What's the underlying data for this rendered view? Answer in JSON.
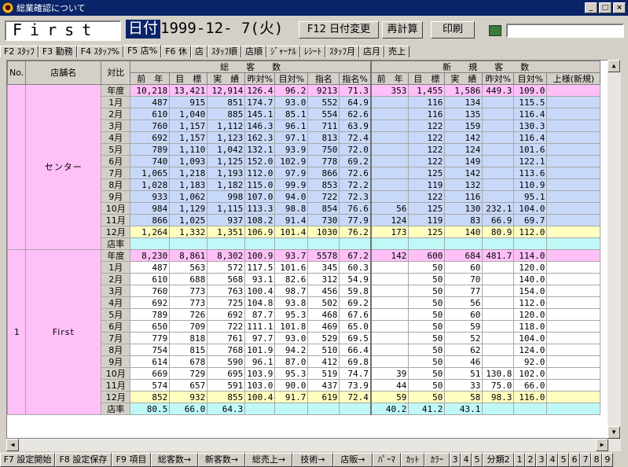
{
  "window": {
    "title": "総業確認について",
    "minimize": "_",
    "maximize": "□",
    "close": "×"
  },
  "toolbar": {
    "store_name": "First",
    "date_label": "日付",
    "date_value": "1999-12- 7(火)",
    "btn_date_change": "F12 日付変更",
    "btn_recalc": "再計算",
    "btn_print": "印刷",
    "calc_value": ""
  },
  "tabs": [
    "F2 ｽﾀｯﾌ",
    "F3 勤務",
    "F4 ｽﾀｯﾌ%",
    "F5 店%",
    "F6 休",
    "店",
    "ｽﾀｯﾌ順",
    "店順",
    "ｼﾞｬｰﾅﾙ",
    "ﾚｼｰﾄ",
    "ｽﾀｯﾌ月",
    "店月",
    "売上"
  ],
  "active_tab": 3,
  "header": {
    "no": "No.",
    "store": "店舗名",
    "compare": "対比",
    "group1": "総　　客　　数",
    "group2": "新　　規　　客　　数",
    "cols1": [
      "前　年",
      "目　標",
      "実　績",
      "昨対%",
      "目対%",
      "指名",
      "指名%"
    ],
    "cols2": [
      "前　年",
      "目　標",
      "実　績",
      "昨対%",
      "目対%",
      "上様(新規)"
    ]
  },
  "sections": [
    {
      "no": "",
      "store": "センター",
      "rows": [
        {
          "m": "年度",
          "t": "year",
          "v": [
            "10,218",
            "13,421",
            "12,914",
            "126.4",
            "96.2",
            "9213",
            "71.3",
            "353",
            "1,455",
            "1,586",
            "449.3",
            "109.0",
            ""
          ]
        },
        {
          "m": "1月",
          "t": "month",
          "v": [
            "487",
            "915",
            "851",
            "174.7",
            "93.0",
            "552",
            "64.9",
            "",
            "116",
            "134",
            "",
            "115.5",
            ""
          ]
        },
        {
          "m": "2月",
          "t": "month",
          "v": [
            "610",
            "1,040",
            "885",
            "145.1",
            "85.1",
            "554",
            "62.6",
            "",
            "116",
            "135",
            "",
            "116.4",
            ""
          ]
        },
        {
          "m": "3月",
          "t": "month",
          "v": [
            "760",
            "1,157",
            "1,112",
            "146.3",
            "96.1",
            "711",
            "63.9",
            "",
            "122",
            "159",
            "",
            "130.3",
            ""
          ]
        },
        {
          "m": "4月",
          "t": "month",
          "v": [
            "692",
            "1,157",
            "1,123",
            "162.3",
            "97.1",
            "813",
            "72.4",
            "",
            "122",
            "142",
            "",
            "116.4",
            ""
          ]
        },
        {
          "m": "5月",
          "t": "month",
          "v": [
            "789",
            "1,110",
            "1,042",
            "132.1",
            "93.9",
            "750",
            "72.0",
            "",
            "122",
            "124",
            "",
            "101.6",
            ""
          ]
        },
        {
          "m": "6月",
          "t": "month",
          "v": [
            "740",
            "1,093",
            "1,125",
            "152.0",
            "102.9",
            "778",
            "69.2",
            "",
            "122",
            "149",
            "",
            "122.1",
            ""
          ]
        },
        {
          "m": "7月",
          "t": "month",
          "v": [
            "1,065",
            "1,218",
            "1,193",
            "112.0",
            "97.9",
            "866",
            "72.6",
            "",
            "125",
            "142",
            "",
            "113.6",
            ""
          ]
        },
        {
          "m": "8月",
          "t": "month",
          "v": [
            "1,028",
            "1,183",
            "1,182",
            "115.0",
            "99.9",
            "853",
            "72.2",
            "",
            "119",
            "132",
            "",
            "110.9",
            ""
          ]
        },
        {
          "m": "9月",
          "t": "month",
          "v": [
            "933",
            "1,062",
            "998",
            "107.0",
            "94.0",
            "722",
            "72.3",
            "",
            "122",
            "116",
            "",
            "95.1",
            ""
          ]
        },
        {
          "m": "10月",
          "t": "month",
          "v": [
            "984",
            "1,129",
            "1,115",
            "113.3",
            "98.8",
            "854",
            "76.6",
            "56",
            "125",
            "130",
            "232.1",
            "104.0",
            ""
          ]
        },
        {
          "m": "11月",
          "t": "month",
          "v": [
            "866",
            "1,025",
            "937",
            "108.2",
            "91.4",
            "730",
            "77.9",
            "124",
            "119",
            "83",
            "66.9",
            "69.7",
            ""
          ]
        },
        {
          "m": "12月",
          "t": "dec",
          "v": [
            "1,264",
            "1,332",
            "1,351",
            "106.9",
            "101.4",
            "1030",
            "76.2",
            "173",
            "125",
            "140",
            "80.9",
            "112.0",
            ""
          ]
        },
        {
          "m": "店率",
          "t": "ratio",
          "v": [
            "",
            "",
            "",
            "",
            "",
            "",
            "",
            "",
            "",
            "",
            "",
            "",
            ""
          ]
        }
      ]
    },
    {
      "no": "1",
      "store": "First",
      "rows": [
        {
          "m": "年度",
          "t": "year",
          "v": [
            "8,230",
            "8,861",
            "8,302",
            "100.9",
            "93.7",
            "5578",
            "67.2",
            "142",
            "600",
            "684",
            "481.7",
            "114.0",
            ""
          ]
        },
        {
          "m": "1月",
          "t": "month2",
          "v": [
            "487",
            "563",
            "572",
            "117.5",
            "101.6",
            "345",
            "60.3",
            "",
            "50",
            "60",
            "",
            "120.0",
            ""
          ]
        },
        {
          "m": "2月",
          "t": "month2",
          "v": [
            "610",
            "688",
            "568",
            "93.1",
            "82.6",
            "312",
            "54.9",
            "",
            "50",
            "70",
            "",
            "140.0",
            ""
          ]
        },
        {
          "m": "3月",
          "t": "month2",
          "v": [
            "760",
            "773",
            "763",
            "100.4",
            "98.7",
            "456",
            "59.8",
            "",
            "50",
            "77",
            "",
            "154.0",
            ""
          ]
        },
        {
          "m": "4月",
          "t": "month2",
          "v": [
            "692",
            "773",
            "725",
            "104.8",
            "93.8",
            "502",
            "69.2",
            "",
            "50",
            "56",
            "",
            "112.0",
            ""
          ]
        },
        {
          "m": "5月",
          "t": "month2",
          "v": [
            "789",
            "726",
            "692",
            "87.7",
            "95.3",
            "468",
            "67.6",
            "",
            "50",
            "60",
            "",
            "120.0",
            ""
          ]
        },
        {
          "m": "6月",
          "t": "month2",
          "v": [
            "650",
            "709",
            "722",
            "111.1",
            "101.8",
            "469",
            "65.0",
            "",
            "50",
            "59",
            "",
            "118.0",
            ""
          ]
        },
        {
          "m": "7月",
          "t": "month2",
          "v": [
            "779",
            "818",
            "761",
            "97.7",
            "93.0",
            "529",
            "69.5",
            "",
            "50",
            "52",
            "",
            "104.0",
            ""
          ]
        },
        {
          "m": "8月",
          "t": "month2",
          "v": [
            "754",
            "815",
            "768",
            "101.9",
            "94.2",
            "510",
            "66.4",
            "",
            "50",
            "62",
            "",
            "124.0",
            ""
          ]
        },
        {
          "m": "9月",
          "t": "month2",
          "v": [
            "614",
            "678",
            "590",
            "96.1",
            "87.0",
            "412",
            "69.8",
            "",
            "50",
            "46",
            "",
            "92.0",
            ""
          ]
        },
        {
          "m": "10月",
          "t": "month2",
          "v": [
            "669",
            "729",
            "695",
            "103.9",
            "95.3",
            "519",
            "74.7",
            "39",
            "50",
            "51",
            "130.8",
            "102.0",
            ""
          ]
        },
        {
          "m": "11月",
          "t": "month2",
          "v": [
            "574",
            "657",
            "591",
            "103.0",
            "90.0",
            "437",
            "73.9",
            "44",
            "50",
            "33",
            "75.0",
            "66.0",
            ""
          ]
        },
        {
          "m": "12月",
          "t": "dec",
          "v": [
            "852",
            "932",
            "855",
            "100.4",
            "91.7",
            "619",
            "72.4",
            "59",
            "50",
            "58",
            "98.3",
            "116.0",
            ""
          ]
        },
        {
          "m": "店率",
          "t": "ratio",
          "v": [
            "80.5",
            "66.0",
            "64.3",
            "",
            "",
            "",
            "",
            "40.2",
            "41.2",
            "43.1",
            "",
            "",
            ""
          ]
        }
      ]
    }
  ],
  "bottom_buttons": [
    "F7 設定開始",
    "F8 設定保存",
    "F9 項目",
    "総客数→",
    "新客数→",
    "総売上→",
    "技術→",
    "店販→",
    "ﾊﾟｰﾏ",
    "ｶｯﾄ",
    "ｶﾗｰ",
    "3",
    "4",
    "5",
    "分類2",
    "1",
    "2",
    "3",
    "4",
    "5",
    "6",
    "7",
    "8",
    "9"
  ]
}
